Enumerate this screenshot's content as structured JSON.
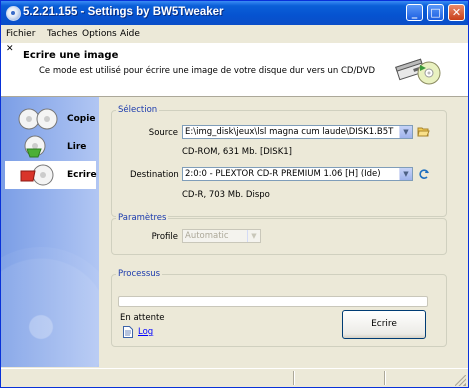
{
  "window": {
    "title": "5.2.21.155 - Settings by BW5Tweaker"
  },
  "menu": [
    "Fichier",
    "Taches",
    "Options",
    "Aide"
  ],
  "header": {
    "title": "Ecrire une image",
    "description": "Ce mode est utilisé pour écrire une image de votre disque dur vers un CD/DVD"
  },
  "sidebar": {
    "items": [
      "Copie",
      "Lire",
      "Ecrire"
    ],
    "selected": "Ecrire"
  },
  "selection": {
    "group_title": "Sélection",
    "source_label": "Source",
    "source_value": "E:\\img_disk\\jeux\\lsl magna cum laude\\DISK1.B5T",
    "source_info": "CD-ROM, 631 Mb. [DISK1]",
    "destination_label": "Destination",
    "destination_value": "2:0:0 - PLEXTOR CD-R   PREMIUM 1.06 [H] (Ide)",
    "destination_info": "CD-R, 703 Mb. Dispo"
  },
  "parameters": {
    "group_title": "Paramètres",
    "profile_label": "Profile",
    "profile_value": "Automatic"
  },
  "process": {
    "group_title": "Processus",
    "progress": 0,
    "status": "En attente",
    "log_label": "Log",
    "action_button": "Ecrire"
  },
  "colors": {
    "accent": "#0a5fd8",
    "group_title": "#1a3aad",
    "sidebar": "#7b9ee6"
  }
}
